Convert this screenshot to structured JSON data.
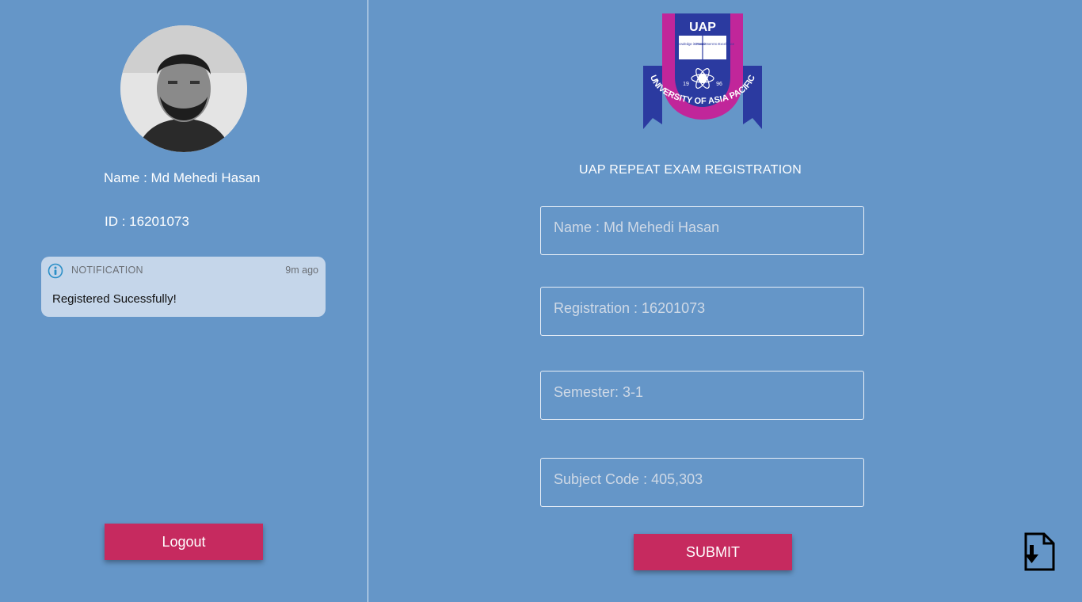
{
  "profile": {
    "name_text": "Name : Md Mehedi Hasan",
    "id_text": "ID : 16201073"
  },
  "notification": {
    "title": "NOTIFICATION",
    "time": "9m ago",
    "message": "Registered Sucessfully!"
  },
  "sidebar": {
    "logout_label": "Logout"
  },
  "logo": {
    "acronym": "UAP",
    "arc_text": "UNIVERSITY OF ASIA PACIFIC",
    "book_left": "Knowledge is Power",
    "book_right": "Commitment to Excellence",
    "year_left": "19",
    "year_right": "96"
  },
  "form": {
    "title": "UAP REPEAT EXAM REGISTRATION",
    "fields": [
      {
        "placeholder": "Name : Md Mehedi Hasan"
      },
      {
        "placeholder": "Registration : 16201073"
      },
      {
        "placeholder": "Semester: 3-1"
      },
      {
        "placeholder": "Subject Code : 405,303"
      }
    ],
    "submit_label": "SUBMIT"
  },
  "colors": {
    "background": "#6596c8",
    "button": "#c62a5f",
    "notification_bg": "#c5d6ea"
  },
  "icons": {
    "notification": "info-circle-icon",
    "download": "file-download-icon"
  }
}
